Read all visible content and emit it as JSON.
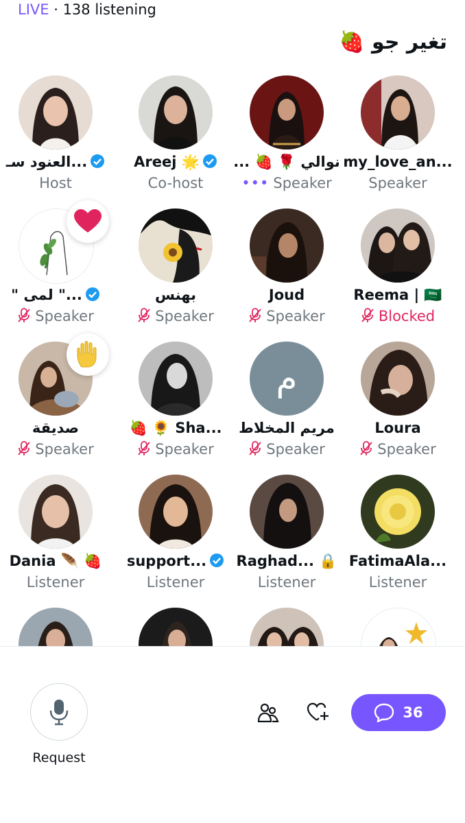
{
  "header": {
    "live_label": "LIVE",
    "listening_text": "· 138 listening"
  },
  "space": {
    "title": "تغير جو 🍓"
  },
  "roles": {
    "host": "Host",
    "cohost": "Co-host",
    "speaker": "Speaker",
    "blocked": "Blocked",
    "listener": "Listener"
  },
  "participants": [
    {
      "name": "العنود سـ...",
      "role": "Host"
    },
    {
      "name": "Areej 🌟",
      "role": "Co-host"
    },
    {
      "name": "... 🍓 🌹 نوالي",
      "role": "Speaker"
    },
    {
      "name": "my_love_an...",
      "role": "Speaker"
    },
    {
      "name": "\" لمى \"...",
      "role": "Speaker"
    },
    {
      "name": "بهنس",
      "role": "Speaker"
    },
    {
      "name": "Joud",
      "role": "Speaker"
    },
    {
      "name": "Reema | 🇸🇦",
      "role": "Blocked"
    },
    {
      "name": "صديقة",
      "role": "Speaker"
    },
    {
      "name": "🍓 🌻 Sha...",
      "role": "Speaker"
    },
    {
      "name": "مريم المخلاط",
      "role": "Speaker"
    },
    {
      "name": "Loura",
      "role": "Speaker"
    },
    {
      "name": "Dania 🪶 🍓",
      "role": "Listener"
    },
    {
      "name": "support...",
      "role": "Listener"
    },
    {
      "name": "Raghad... 🔒",
      "role": "Listener"
    },
    {
      "name": "FatimaAla...",
      "role": "Listener"
    }
  ],
  "placeholder_initial": "م",
  "footer": {
    "request_label": "Request",
    "chat_count": "36"
  },
  "colors": {
    "accent": "#7856ff",
    "verified": "#1d9bf0",
    "blocked": "#e0245e",
    "muted": "#e0245e"
  }
}
